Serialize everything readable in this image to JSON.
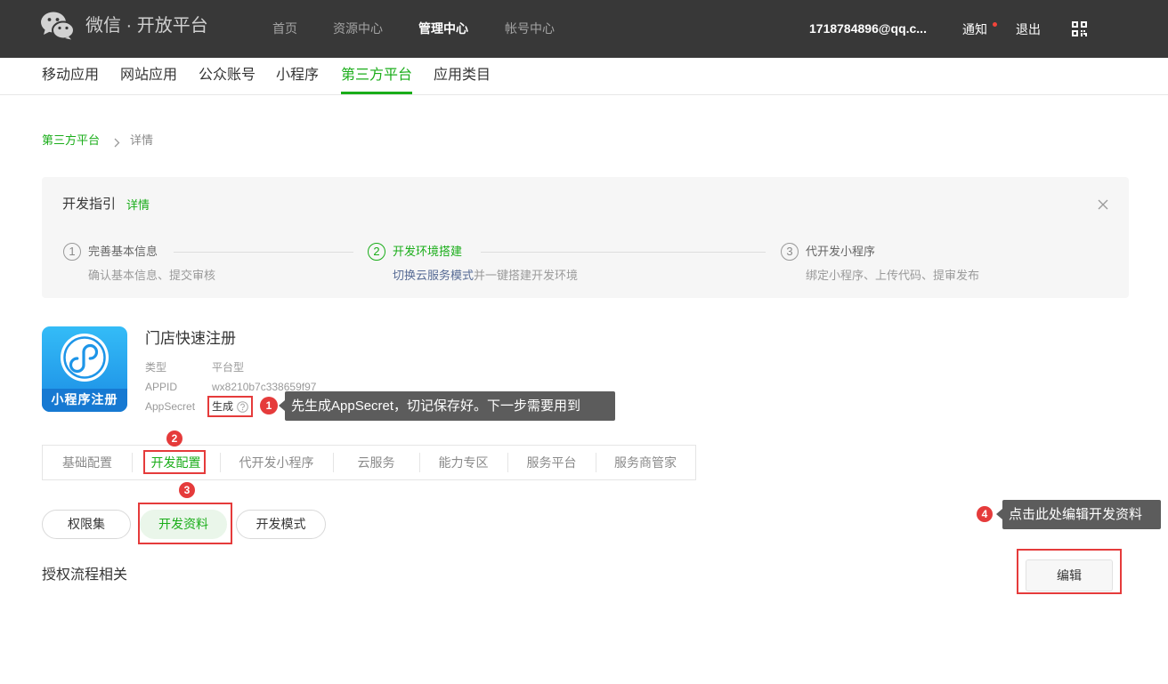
{
  "header": {
    "brand": "微信 · 开放平台",
    "nav": [
      {
        "label": "首页",
        "active": false
      },
      {
        "label": "资源中心",
        "active": false
      },
      {
        "label": "管理中心",
        "active": true
      },
      {
        "label": "帐号中心",
        "active": false
      }
    ],
    "user_email": "1718784896@qq.c...",
    "notify_label": "通知",
    "has_unread": true,
    "logout_label": "退出",
    "icons": {
      "logo": "wechat-logo-icon",
      "unread": "unread-dot-icon",
      "qrcode": "qr-code-icon"
    }
  },
  "subnav": {
    "items": [
      {
        "label": "移动应用",
        "active": false
      },
      {
        "label": "网站应用",
        "active": false
      },
      {
        "label": "公众账号",
        "active": false
      },
      {
        "label": "小程序",
        "active": false
      },
      {
        "label": "第三方平台",
        "active": true
      },
      {
        "label": "应用类目",
        "active": false
      }
    ]
  },
  "breadcrumb": {
    "parent": "第三方平台",
    "current": "详情",
    "separator_icon": "chevron-right-icon"
  },
  "guide": {
    "title": "开发指引",
    "detail_link": "详情",
    "close_icon": "close-icon",
    "steps": [
      {
        "num": "1",
        "title": "完善基本信息",
        "desc": "确认基本信息、提交审核",
        "active": false
      },
      {
        "num": "2",
        "title": "开发环境搭建",
        "desc_link": "切换云服务模式",
        "desc": "并一键搭建开发环境",
        "active": true
      },
      {
        "num": "3",
        "title": "代开发小程序",
        "desc": "绑定小程序、上传代码、提审发布",
        "active": false
      }
    ]
  },
  "app": {
    "icon_caption": "小程序注册",
    "name": "门店快速注册",
    "type_label": "类型",
    "type_value": "平台型",
    "appid_label": "APPID",
    "appid_value": "wx8210b7c338659f97",
    "secret_label": "AppSecret",
    "secret_action": "生成",
    "help_icon": "help-circle-icon"
  },
  "tabs": {
    "items": [
      {
        "label": "基础配置",
        "active": false
      },
      {
        "label": "开发配置",
        "active": true
      },
      {
        "label": "代开发小程序",
        "active": false
      },
      {
        "label": "云服务",
        "active": false
      },
      {
        "label": "能力专区",
        "active": false
      },
      {
        "label": "服务平台",
        "active": false
      },
      {
        "label": "服务商管家",
        "active": false
      }
    ]
  },
  "subtabs": {
    "items": [
      {
        "label": "权限集",
        "active": false
      },
      {
        "label": "开发资料",
        "active": true
      },
      {
        "label": "开发模式",
        "active": false
      }
    ]
  },
  "section": {
    "title": "授权流程相关",
    "edit_label": "编辑"
  },
  "annotations": [
    {
      "num": "1",
      "text": "先生成AppSecret，切记保存好。下一步需要用到"
    },
    {
      "num": "2"
    },
    {
      "num": "3"
    },
    {
      "num": "4",
      "text": "点击此处编辑开发资料"
    }
  ],
  "colors": {
    "header_bg": "#383838",
    "brand_green": "#1aad19",
    "link_blue": "#576b95",
    "annotation_red": "#e53b3b",
    "tooltip_bg": "#5c5c5c",
    "guide_bg": "#f6f6f6"
  }
}
